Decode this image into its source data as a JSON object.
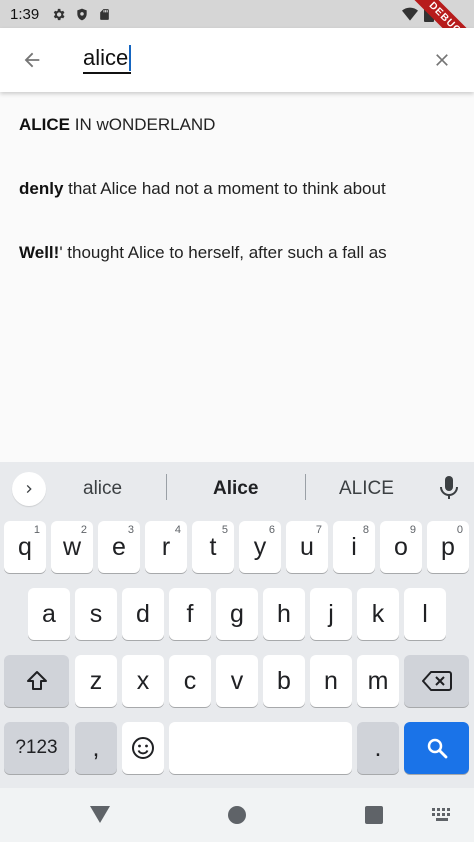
{
  "status_bar": {
    "time": "1:39",
    "icons": [
      "gear-icon",
      "shield-icon",
      "sd-card-icon",
      "wifi-icon",
      "battery-icon"
    ],
    "debug_banner": "DEBUG"
  },
  "app_bar": {
    "back_icon": "arrow-back-icon",
    "search_value": "alice",
    "clear_icon": "close-icon"
  },
  "results": [
    {
      "match": "ALICE",
      "rest": " IN wONDERLAND"
    },
    {
      "match": "denly",
      "rest": " that Alice had not a moment to think about"
    },
    {
      "match": "Well!",
      "rest": "' thought Alice to herself, after such a fall as"
    }
  ],
  "keyboard": {
    "suggestions": [
      "alice",
      "Alice",
      "ALICE"
    ],
    "row1": [
      {
        "key": "q",
        "hint": "1"
      },
      {
        "key": "w",
        "hint": "2"
      },
      {
        "key": "e",
        "hint": "3"
      },
      {
        "key": "r",
        "hint": "4"
      },
      {
        "key": "t",
        "hint": "5"
      },
      {
        "key": "y",
        "hint": "6"
      },
      {
        "key": "u",
        "hint": "7"
      },
      {
        "key": "i",
        "hint": "8"
      },
      {
        "key": "o",
        "hint": "9"
      },
      {
        "key": "p",
        "hint": "0"
      }
    ],
    "row2": [
      "a",
      "s",
      "d",
      "f",
      "g",
      "h",
      "j",
      "k",
      "l"
    ],
    "row3": [
      "z",
      "x",
      "c",
      "v",
      "b",
      "n",
      "m"
    ],
    "symbols_label": "?123",
    "comma_label": ",",
    "period_label": ".",
    "accent_color": "#1a73e8"
  },
  "nav_bar": {
    "icons": [
      "back-triangle-icon",
      "home-circle-icon",
      "recents-square-icon",
      "keyboard-switch-icon"
    ]
  }
}
